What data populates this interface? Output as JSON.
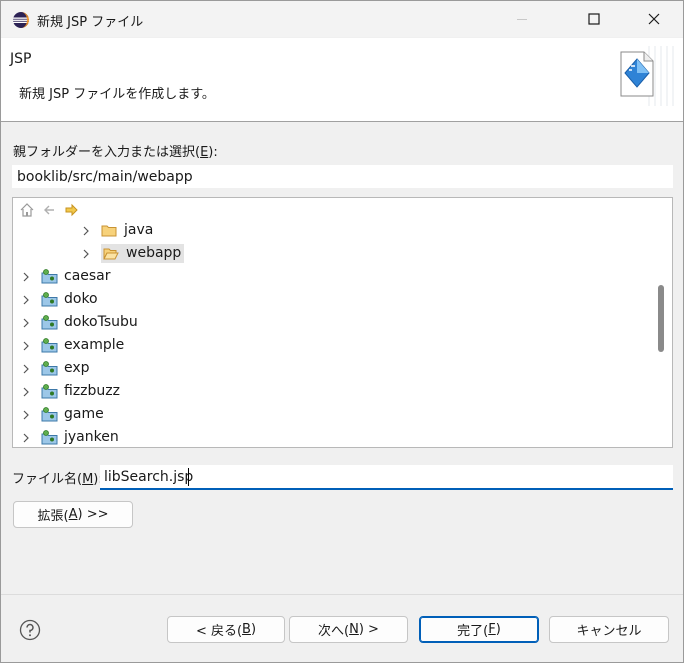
{
  "window": {
    "title": "新規 JSP ファイル"
  },
  "banner": {
    "title": "JSP",
    "description": "新規 JSP ファイルを作成します。"
  },
  "parent_folder": {
    "label": "親フォルダーを入力または選択(",
    "mnemonic": "E",
    "label_suffix": "):",
    "value": "booklib/src/main/webapp"
  },
  "tree": {
    "toolbar": [
      "home-icon",
      "back-arrow-icon",
      "forward-arrow-icon"
    ],
    "children": [
      {
        "label": "java",
        "icon": "folder-icon"
      },
      {
        "label": "webapp",
        "icon": "folder-open-icon",
        "selected": true
      }
    ],
    "projects": [
      {
        "label": "caesar",
        "icon": "project-icon"
      },
      {
        "label": "doko",
        "icon": "project-icon"
      },
      {
        "label": "dokoTsubu",
        "icon": "project-icon"
      },
      {
        "label": "example",
        "icon": "project-icon"
      },
      {
        "label": "exp",
        "icon": "project-icon"
      },
      {
        "label": "fizzbuzz",
        "icon": "project-icon"
      },
      {
        "label": "game",
        "icon": "project-icon"
      },
      {
        "label": "jyanken",
        "icon": "project-icon"
      }
    ]
  },
  "file_name": {
    "label": "ファイル名(",
    "mnemonic": "M",
    "label_suffix": "):",
    "value": "libSearch.jsp"
  },
  "buttons": {
    "advanced_prefix": "拡張(",
    "advanced_mnemonic": "A",
    "advanced_suffix": ") >>",
    "back_prefix": "< 戻る(",
    "back_mnemonic": "B",
    "back_suffix": ")",
    "next_prefix": "次へ(",
    "next_mnemonic": "N",
    "next_suffix": ") >",
    "finish_prefix": "完了(",
    "finish_mnemonic": "F",
    "finish_suffix": ")",
    "cancel": "キャンセル"
  },
  "colors": {
    "accent": "#005fb8",
    "folder": "#e8b24a",
    "selected_row": "#e3e3e3"
  }
}
